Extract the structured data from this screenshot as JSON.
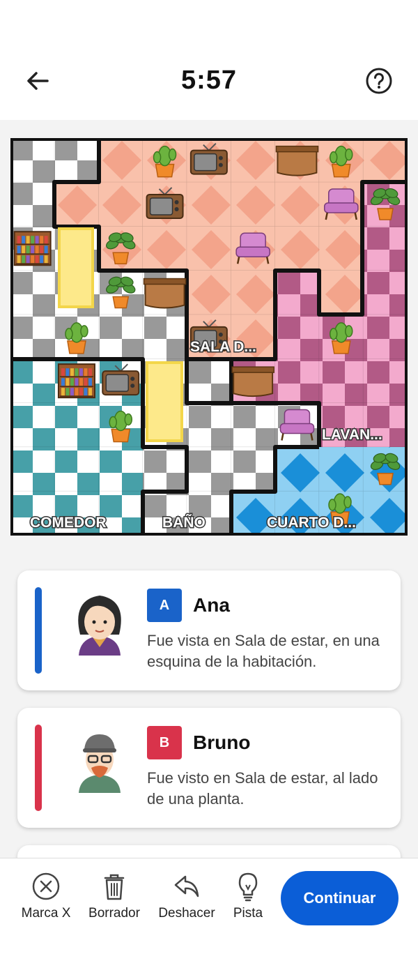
{
  "header": {
    "timer": "5:57",
    "back_icon": "arrow-left-icon",
    "help_icon": "question-circle-icon"
  },
  "rooms": [
    {
      "label": "SALA D...",
      "color": "#f5a893"
    },
    {
      "label": "LAVAN...",
      "color": "#e48fb8"
    },
    {
      "label": "COMEDOR",
      "color": "#3fa3ad"
    },
    {
      "label": "BAÑO",
      "color": "#9b9b9b"
    },
    {
      "label": "CUARTO D...",
      "color": "#1c8fd8"
    }
  ],
  "suspects": [
    {
      "letter": "A",
      "name": "Ana",
      "color": "#1a63c9",
      "clue": "Fue vista en Sala de estar, en una esquina de la habitación."
    },
    {
      "letter": "B",
      "name": "Bruno",
      "color": "#d9334b",
      "clue": "Fue visto en Sala de estar, al lado de una planta."
    }
  ],
  "toolbar": {
    "mark_x": "Marca X",
    "eraser": "Borrador",
    "undo": "Deshacer",
    "hint": "Pista",
    "continue": "Continuar"
  }
}
